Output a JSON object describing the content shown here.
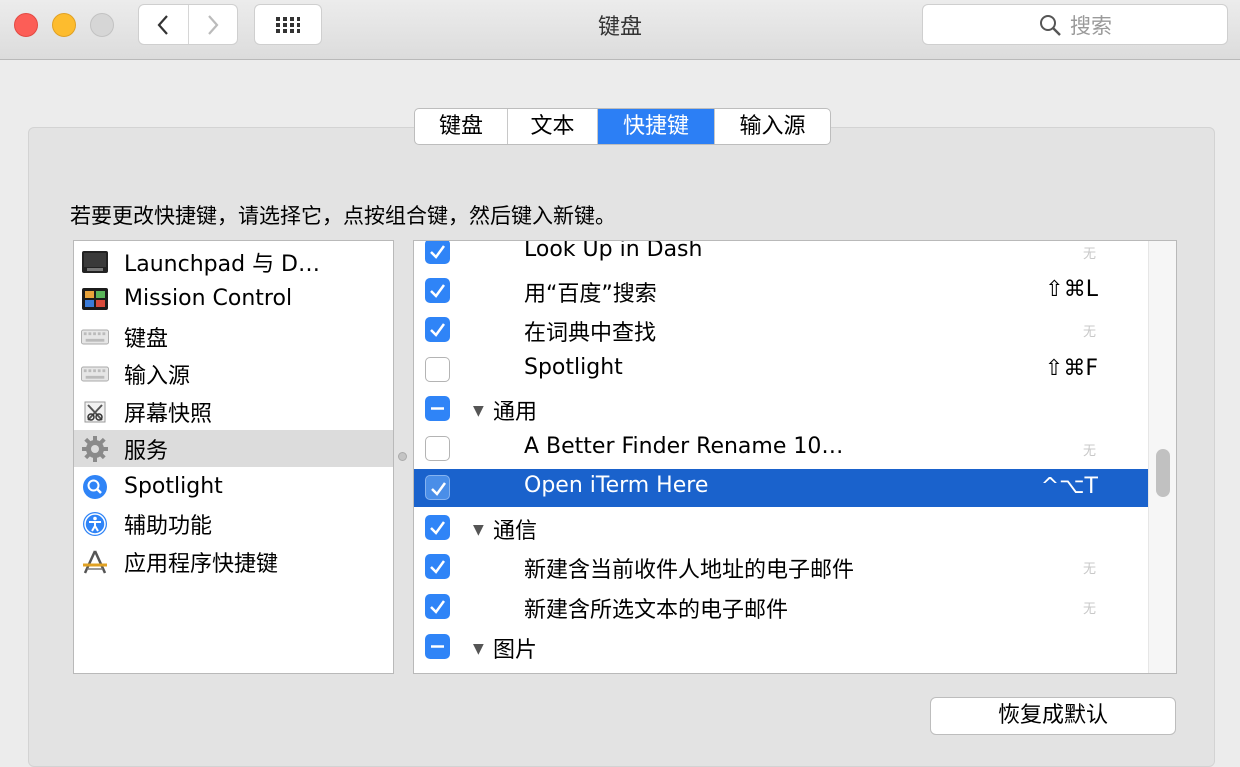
{
  "window": {
    "title": "键盘",
    "search_placeholder": "搜索"
  },
  "tabs": [
    {
      "label": "键盘",
      "active": false
    },
    {
      "label": "文本",
      "active": false
    },
    {
      "label": "快捷键",
      "active": true
    },
    {
      "label": "输入源",
      "active": false
    }
  ],
  "instruction": "若要更改快捷键，请选择它，点按组合键，然后键入新键。",
  "categories": [
    {
      "label": "Launchpad 与 D…",
      "icon": "launchpad-icon"
    },
    {
      "label": "Mission Control",
      "icon": "mission-control-icon"
    },
    {
      "label": "键盘",
      "icon": "keyboard-icon"
    },
    {
      "label": "输入源",
      "icon": "input-source-icon"
    },
    {
      "label": "屏幕快照",
      "icon": "screenshot-icon"
    },
    {
      "label": "服务",
      "icon": "gear-icon",
      "selected": true
    },
    {
      "label": "Spotlight",
      "icon": "spotlight-icon"
    },
    {
      "label": "辅助功能",
      "icon": "accessibility-icon"
    },
    {
      "label": "应用程序快捷键",
      "icon": "app-shortcuts-icon"
    }
  ],
  "shortcuts": [
    {
      "label": "Look Up in Dash",
      "key": "无",
      "state": "checked",
      "group": false
    },
    {
      "label": "用“百度”搜索",
      "key": "⇧⌘L",
      "state": "checked",
      "group": false
    },
    {
      "label": "在词典中查找",
      "key": "无",
      "state": "checked",
      "group": false
    },
    {
      "label": "Spotlight",
      "key": "⇧⌘F",
      "state": "unchecked",
      "group": false
    },
    {
      "label": "通用",
      "key": "",
      "state": "mixed",
      "group": true
    },
    {
      "label": "A Better Finder Rename 10…",
      "key": "无",
      "state": "unchecked",
      "group": false
    },
    {
      "label": "Open iTerm Here",
      "key": "^⌥T",
      "state": "checked",
      "group": false,
      "selected": true
    },
    {
      "label": "通信",
      "key": "",
      "state": "checked",
      "group": true
    },
    {
      "label": "新建含当前收件人地址的电子邮件",
      "key": "无",
      "state": "checked",
      "group": false
    },
    {
      "label": "新建含所选文本的电子邮件",
      "key": "无",
      "state": "checked",
      "group": false
    },
    {
      "label": "图片",
      "key": "",
      "state": "mixed",
      "group": true
    }
  ],
  "restore_button": "恢复成默认",
  "colors": {
    "accent": "#2c7ff5",
    "selection": "#1a62cc"
  }
}
